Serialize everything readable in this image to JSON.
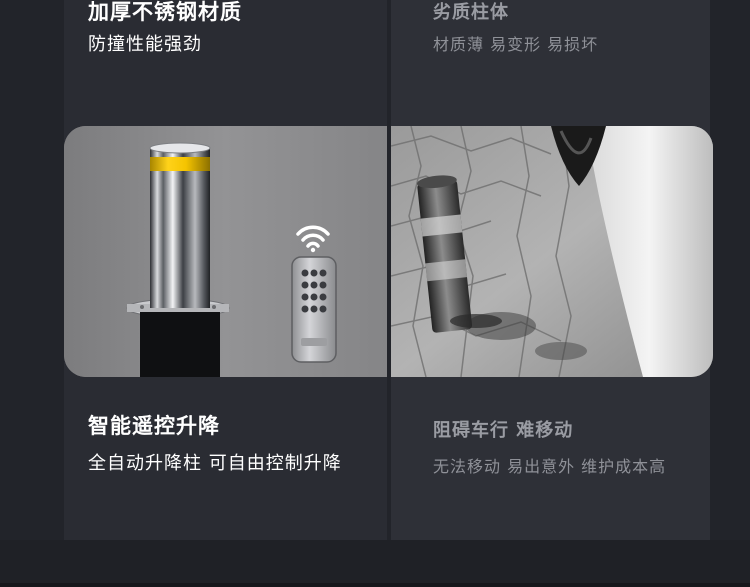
{
  "left_feature": {
    "title": "加厚不锈钢材质",
    "subtitle": "防撞性能强劲"
  },
  "right_feature": {
    "title": "劣质柱体",
    "subtitle": "材质薄  易变形  易损坏"
  },
  "left_feature_2": {
    "title": "智能遥控升降",
    "subtitle": "全自动升降柱  可自由控制升降"
  },
  "right_feature_2": {
    "title": "阻碍车行 难移动",
    "subtitle": "无法移动  易出意外  维护成本高"
  },
  "colors": {
    "page_bg": "#22242a",
    "reflective_band": "#f5c400",
    "heading_white": "#ffffff",
    "heading_grey": "#9a9ca3"
  },
  "icons": [
    "wifi-icon",
    "remote-control-icon"
  ]
}
